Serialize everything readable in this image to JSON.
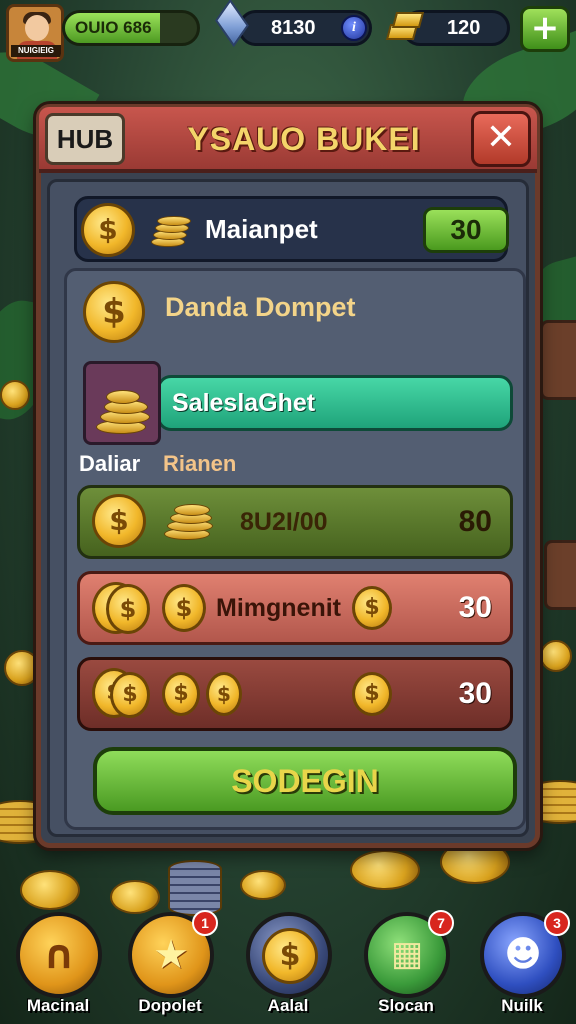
{
  "topbar": {
    "xp_text": "OUIO 686",
    "xp_fill": 0.72,
    "gems_value": "8130",
    "gold_value": "120",
    "avatar_tag": "NUIGIEIG"
  },
  "panel": {
    "tab_label": "HUB",
    "title": "YSAUO BUKEI",
    "close_symbol": "✕",
    "top_row": {
      "label": "Maianpet",
      "value": "30"
    },
    "section": {
      "title": "Danda Dompet",
      "bar_label": "SaleslaGhet",
      "sub_left": "Daliar",
      "sub_right": "Rianen"
    },
    "entries": [
      {
        "label": "8U2I/00",
        "amount": "80"
      },
      {
        "label": "Mimgnenit",
        "amount": "30"
      },
      {
        "label": "",
        "amount": "30"
      }
    ],
    "action_button": "SODEGIN"
  },
  "nav": [
    {
      "label": "Macinal",
      "icon": "horseshoe-icon",
      "color": "#f0b02a",
      "badge": ""
    },
    {
      "label": "Dopolet",
      "icon": "star-wand-icon",
      "color": "#f0b02a",
      "badge": "1"
    },
    {
      "label": "Aalal",
      "icon": "dollar-coin-icon",
      "color": "#4a5a8a",
      "badge": ""
    },
    {
      "label": "Slocan",
      "icon": "grid-icon",
      "color": "#4ab04a",
      "badge": "7"
    },
    {
      "label": "Nuilk",
      "icon": "ghost-face-icon",
      "color": "#3a5ac0",
      "badge": "3"
    }
  ]
}
